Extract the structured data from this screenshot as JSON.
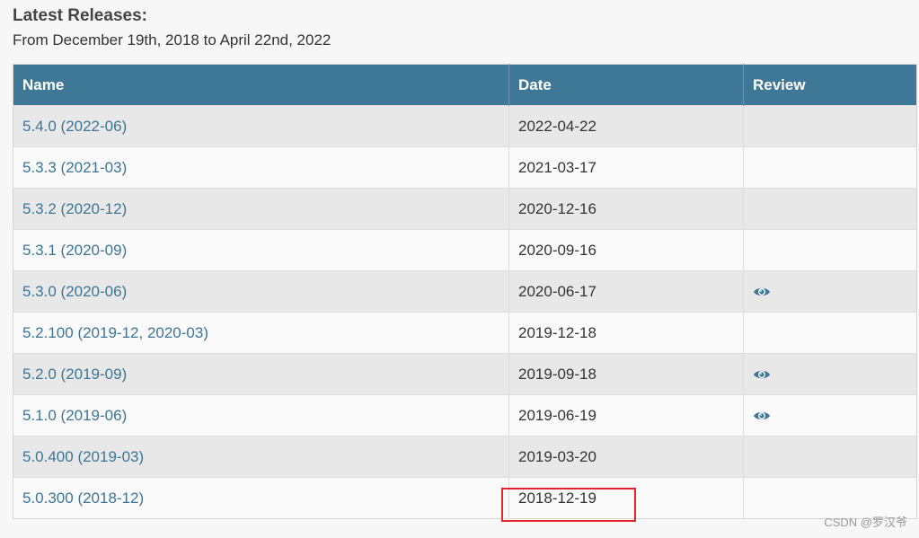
{
  "header": {
    "title": "Latest Releases:",
    "subtitle": "From December 19th, 2018 to April 22nd, 2022"
  },
  "table": {
    "columns": [
      "Name",
      "Date",
      "Review"
    ],
    "rows": [
      {
        "name": "5.4.0 (2022-06)",
        "date": "2022-04-22",
        "review": false
      },
      {
        "name": "5.3.3 (2021-03)",
        "date": "2021-03-17",
        "review": false
      },
      {
        "name": "5.3.2 (2020-12)",
        "date": "2020-12-16",
        "review": false
      },
      {
        "name": "5.3.1 (2020-09)",
        "date": "2020-09-16",
        "review": false
      },
      {
        "name": "5.3.0 (2020-06)",
        "date": "2020-06-17",
        "review": true
      },
      {
        "name": "5.2.100 (2019-12, 2020-03)",
        "date": "2019-12-18",
        "review": false
      },
      {
        "name": "5.2.0 (2019-09)",
        "date": "2019-09-18",
        "review": true
      },
      {
        "name": "5.1.0 (2019-06)",
        "date": "2019-06-19",
        "review": true
      },
      {
        "name": "5.0.400 (2019-03)",
        "date": "2019-03-20",
        "review": false
      },
      {
        "name": "5.0.300 (2018-12)",
        "date": "2018-12-19",
        "review": false
      }
    ]
  },
  "review_icon": "eye-icon",
  "colors": {
    "header_bg": "#3f7896",
    "link": "#3c7596",
    "highlight": "#e0282d",
    "row_odd": "#e8e8e8",
    "row_even": "#fafafa"
  },
  "watermark": "CSDN @罗汉爷"
}
